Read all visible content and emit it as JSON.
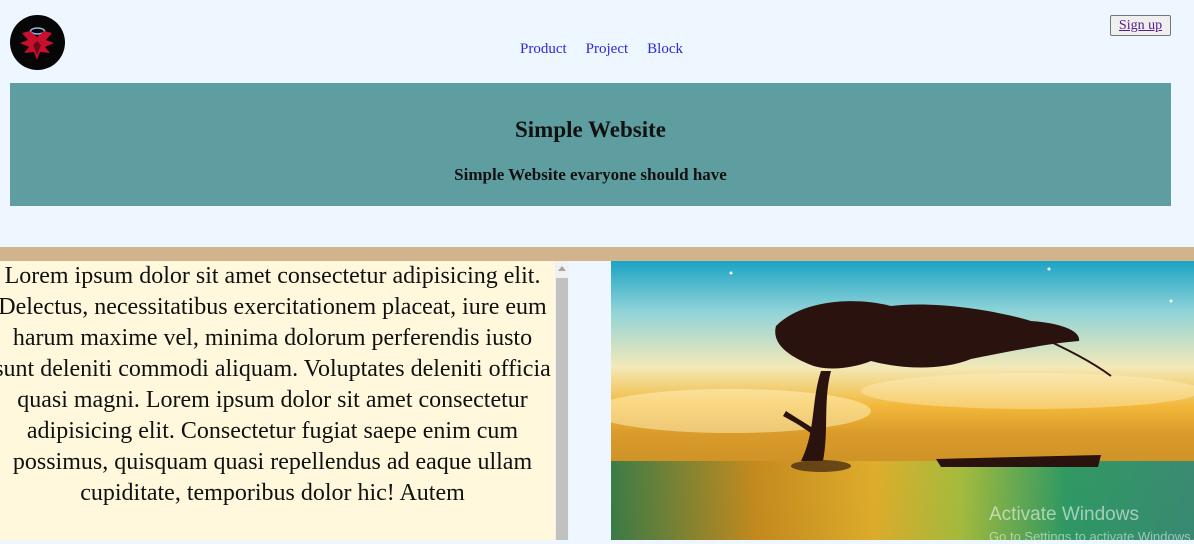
{
  "nav": {
    "items": [
      {
        "label": "Product"
      },
      {
        "label": "Project"
      },
      {
        "label": "Block"
      }
    ],
    "signup_label": "Sign up"
  },
  "banner": {
    "title": "Simple Website",
    "subtitle": "Simple Website evaryone should have"
  },
  "content": {
    "paragraph": "Lorem ipsum dolor sit amet consectetur adipisicing elit. Delectus, necessitatibus exercitationem placeat, iure eum harum maxime vel, minima dolorum perferendis iusto sunt deleniti commodi aliquam. Voluptates deleniti officia quasi magni. Lorem ipsum dolor sit amet consectetur adipisicing elit. Consectetur fugiat saepe enim cum possimus, quisquam quasi repellendus ad eaque ullam cupiditate, temporibus dolor hic! Autem"
  },
  "watermark": {
    "line1": "Activate Windows",
    "line2": "Go to Settings to activate Windows."
  },
  "colors": {
    "page_bg": "#eef7ff",
    "banner_bg": "#5f9ea0",
    "stripe": "#d2b48c",
    "text_panel_bg": "#fff8dc",
    "nav_link": "#2a2ad6"
  }
}
